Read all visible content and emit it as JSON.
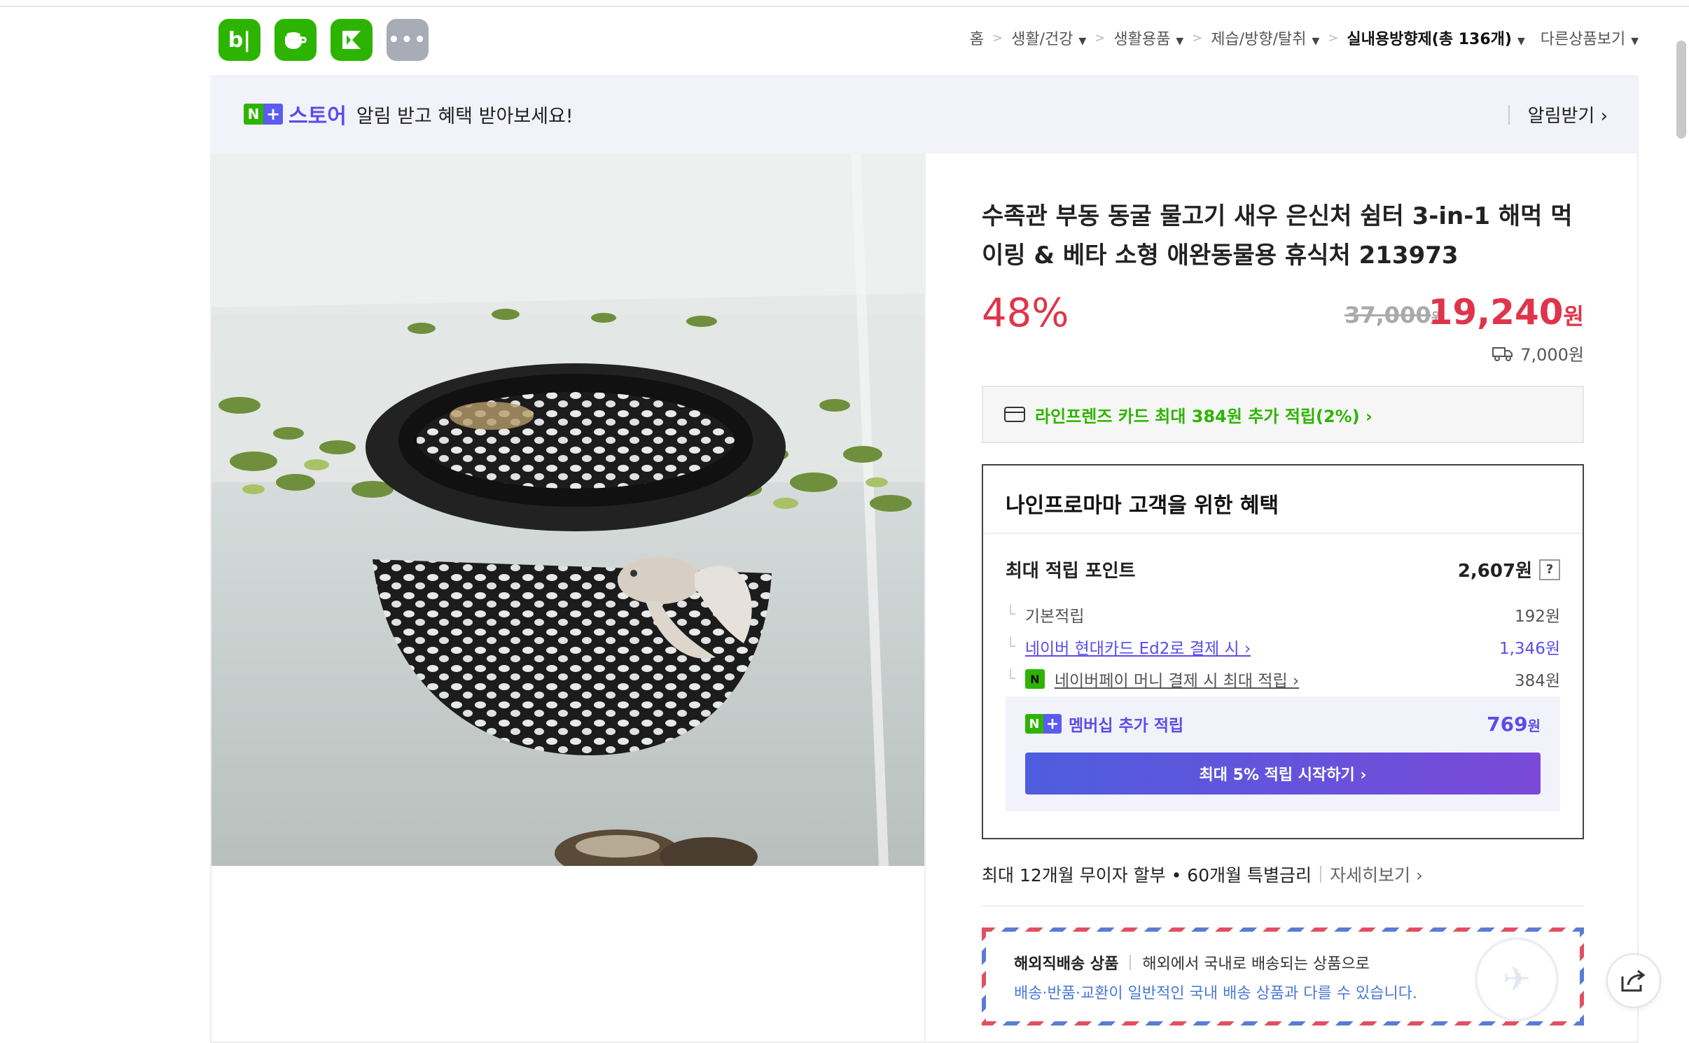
{
  "apps": [
    {
      "name": "blog",
      "glyph": "b|"
    },
    {
      "name": "cafe",
      "glyph": "☕"
    },
    {
      "name": "kin",
      "glyph": "K"
    },
    {
      "name": "more",
      "glyph": "•••"
    }
  ],
  "breadcrumb": {
    "home": "홈",
    "items": [
      "생활/건강",
      "생활용품",
      "제습/방향/탈취",
      "실내용방향제(총 136개)",
      "다른상품보기"
    ]
  },
  "store_banner": {
    "badge_n": "N",
    "badge_plus": "+",
    "store_word": "스토어",
    "message": "알림 받고 혜택 받아보세요!",
    "notify_label": "알림받기 ›"
  },
  "product": {
    "title": "수족관 부동 동굴 물고기 새우 은신처 쉼터 3-in-1 해먹 먹이링 & 베타 소형 애완동물용 휴식처 213973",
    "discount": "48%",
    "original_price": "37,000",
    "original_unit": "원",
    "sale_price": "19,240",
    "sale_unit": "원",
    "shipping_fee": "7,000원"
  },
  "card_promo": {
    "text": "라인프렌즈 카드 최대 384원 추가 적립(2%) ›"
  },
  "benefits": {
    "title": "나인프로마마 고객을 위한 혜택",
    "max_points_label": "최대 적립 포인트",
    "max_points_value": "2,607원",
    "help": "?",
    "rows": [
      {
        "label": "기본적립",
        "value": "192원"
      },
      {
        "label": "네이버 현대카드 Ed2로 결제 시 ›",
        "value": "1,346원"
      },
      {
        "label": "네이버페이 머니 결제 시 최대 적립 ›",
        "value": "384원"
      }
    ],
    "membership_label": "멤버십 추가 적립",
    "membership_value": "769",
    "membership_unit": "원",
    "membership_button": "최대 5% 적립 시작하기 ›"
  },
  "installment": {
    "text": "최대 12개월 무이자 할부 • 60개월 특별금리",
    "more": "자세히보기 ›"
  },
  "overseas": {
    "title": "해외직배송 상품",
    "desc": "해외에서 국내로 배송되는 상품으로",
    "note": "배송·반품·교환이 일반적인 국내 배송 상품과 다를 수 있습니다."
  },
  "colors": {
    "naver_green": "#2db400",
    "price_red": "#e0344a",
    "purple": "#5b4ce8"
  }
}
